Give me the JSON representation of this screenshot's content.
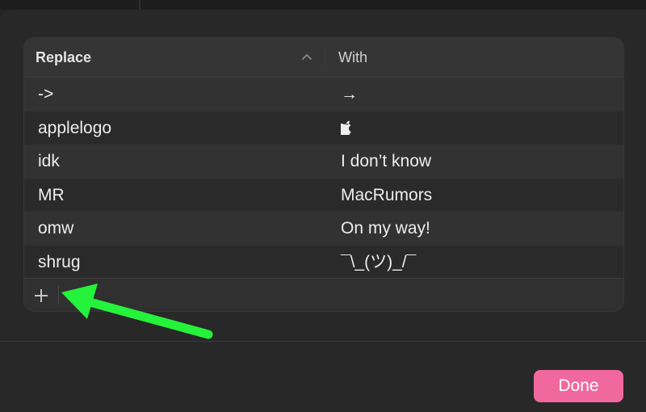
{
  "table": {
    "columns": {
      "replace": "Replace",
      "with": "With"
    },
    "rows": [
      {
        "replace": "->",
        "with": "→"
      },
      {
        "replace": "applelogo",
        "with": ""
      },
      {
        "replace": "idk",
        "with": "I don’t know"
      },
      {
        "replace": "MR",
        "with": "MacRumors"
      },
      {
        "replace": "omw",
        "with": "On my way!"
      },
      {
        "replace": "shrug",
        "with": "¯\\_(ツ)_/¯"
      }
    ],
    "sort_icon": "chevron-up-icon",
    "add_icon": "plus-icon"
  },
  "footer": {
    "done_label": "Done"
  },
  "annotation": {
    "arrow_color": "#25f23a"
  },
  "colors": {
    "accent": "#f1689f"
  }
}
